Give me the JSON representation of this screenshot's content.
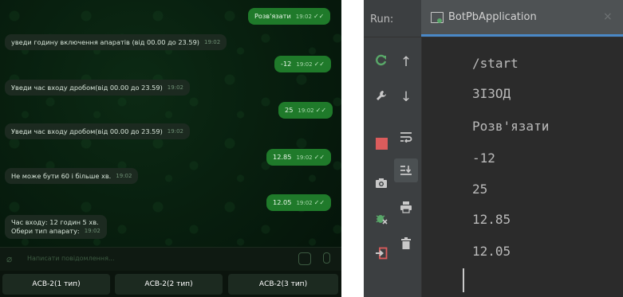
{
  "telegram": {
    "messages": [
      {
        "dir": "out",
        "text": "Розв'язати",
        "time": "19:02"
      },
      {
        "dir": "in",
        "text": "уведи годину включення апаратів (від 00.00 до 23.59)",
        "time": "19:02"
      },
      {
        "dir": "out",
        "text": "-12",
        "time": "19:02"
      },
      {
        "dir": "in",
        "text": "Уведи час входу дробом(від 00.00 до 23.59)",
        "time": "19:02"
      },
      {
        "dir": "out",
        "text": "25",
        "time": "19:02"
      },
      {
        "dir": "in",
        "text": "Уведи час входу дробом(від 00.00 до 23.59)",
        "time": "19:02"
      },
      {
        "dir": "out",
        "text": "12.85",
        "time": "19:02"
      },
      {
        "dir": "in",
        "text": "Не може бути 60 і більше хв.",
        "time": "19:02"
      },
      {
        "dir": "out",
        "text": "12.05",
        "time": "19:02"
      },
      {
        "dir": "in",
        "lines": [
          "Час входу: 12 годин 5 хв.",
          "Обери тип апарату:"
        ],
        "time": "19:02"
      }
    ],
    "input_placeholder": "Написати повідомлення...",
    "keyboard": [
      "АСВ-2(1 тип)",
      "АСВ-2(2 тип)",
      "АСВ-2(3 тип)"
    ]
  },
  "ide": {
    "run_label": "Run:",
    "tab_title": "BotPbApplication",
    "tab_close": "×",
    "console_lines": [
      "/start",
      "ЗІЗОД",
      "Розв'язати",
      "-12",
      "25",
      "12.85",
      "12.05"
    ],
    "colors": {
      "rerun": "#59a869",
      "stop": "#db5c5c",
      "accent": "#4a88c7"
    },
    "toolbar_icons": [
      "rerun-icon",
      "wrench-icon",
      "stop-icon",
      "camera-icon",
      "bug-icon",
      "exit-icon",
      "arrow-up-icon",
      "arrow-down-icon",
      "soft-wrap-icon",
      "scroll-to-end-icon",
      "print-icon",
      "trash-icon"
    ]
  }
}
